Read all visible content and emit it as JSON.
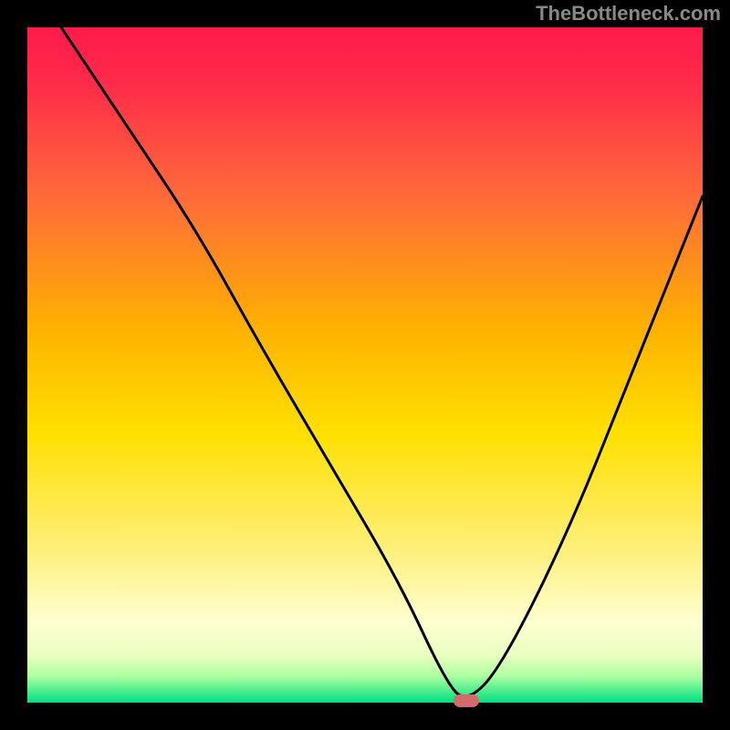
{
  "watermark": "TheBottleneck.com",
  "chart_data": {
    "type": "line",
    "title": "",
    "xlabel": "",
    "ylabel": "",
    "xlim": [
      0,
      100
    ],
    "ylim": [
      0,
      100
    ],
    "x": [
      5,
      15,
      25,
      35,
      45,
      55,
      62,
      65,
      70,
      80,
      90,
      100
    ],
    "values": [
      100,
      85,
      70,
      52,
      35,
      18,
      3,
      0,
      5,
      25,
      50,
      75
    ],
    "optimum_x": 65,
    "background_gradient": [
      "#ff1a4a",
      "#ff6a3a",
      "#ffb300",
      "#ffe000",
      "#fff080",
      "#ffffd0",
      "#d0ffb0",
      "#00e080"
    ],
    "marker": {
      "x": 65,
      "y": 0,
      "color": "#d46a6a"
    }
  },
  "frame": {
    "inner_left": 30,
    "inner_top": 30,
    "inner_width": 740,
    "inner_height": 740,
    "border_color": "#000000"
  }
}
